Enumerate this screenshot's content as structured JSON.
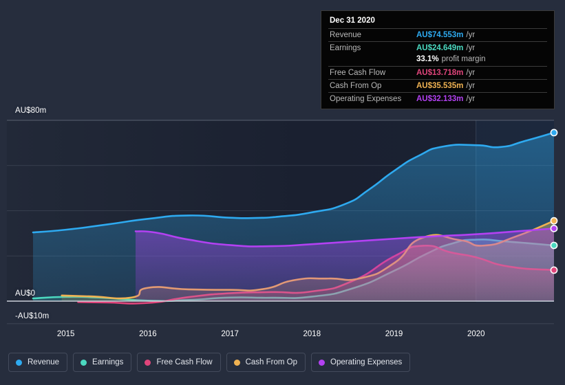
{
  "chart_data": {
    "type": "area",
    "title": "",
    "xlabel": "",
    "ylabel": "",
    "currency": "AU$",
    "ylim": [
      -10,
      90
    ],
    "grid": true,
    "legend_position": "bottom",
    "y_ticks": [
      "AU$80m",
      "AU$0",
      "-AU$10m"
    ],
    "y_tick_values": [
      80,
      0,
      -10
    ],
    "x_ticks": [
      "2015",
      "2016",
      "2017",
      "2018",
      "2019",
      "2020"
    ],
    "x_tick_values": [
      2015,
      2016,
      2017,
      2018,
      2019,
      2020
    ],
    "forecast_divider_x": 2020.0,
    "series": [
      {
        "name": "Revenue",
        "color": "#2eaaf0",
        "x": [
          2014.6,
          2015.0,
          2015.5,
          2016.0,
          2016.5,
          2017.0,
          2017.3,
          2017.6,
          2018.0,
          2018.4,
          2018.7,
          2019.0,
          2019.3,
          2019.6,
          2020.0,
          2020.3,
          2020.6,
          2020.95
        ],
        "values": [
          30.4,
          31.6,
          33.9,
          36.4,
          37.9,
          36.9,
          36.8,
          37.4,
          39.3,
          42.9,
          49.5,
          57.6,
          64.3,
          68.4,
          69.0,
          68.2,
          70.9,
          74.553
        ],
        "end_value": 74.553
      },
      {
        "name": "Earnings",
        "color": "#4bd9c0",
        "x": [
          2014.6,
          2015.0,
          2015.4,
          2016.0,
          2016.5,
          2017.0,
          2017.5,
          2018.0,
          2018.5,
          2019.0,
          2019.4,
          2019.7,
          2020.0,
          2020.4,
          2020.95
        ],
        "values": [
          1.2,
          1.9,
          1.6,
          0.2,
          0.5,
          1.6,
          1.5,
          2.0,
          5.7,
          13.4,
          21.0,
          25.4,
          27.2,
          26.3,
          24.649
        ],
        "end_value": 24.649
      },
      {
        "name": "Free Cash Flow",
        "color": "#e0457b",
        "x": [
          2015.15,
          2015.5,
          2016.0,
          2016.5,
          2017.0,
          2017.5,
          2018.0,
          2018.5,
          2019.0,
          2019.35,
          2019.7,
          2020.0,
          2020.4,
          2020.95
        ],
        "values": [
          -0.4,
          -0.6,
          -0.8,
          1.8,
          3.5,
          4.0,
          4.3,
          9.0,
          19.8,
          24.5,
          21.5,
          19.4,
          15.3,
          13.718
        ],
        "end_value": 13.718
      },
      {
        "name": "Cash From Op",
        "color": "#f0b252",
        "x": [
          2014.95,
          2015.3,
          2015.8,
          2016.0,
          2016.5,
          2017.0,
          2017.4,
          2017.8,
          2018.2,
          2018.6,
          2019.0,
          2019.35,
          2019.8,
          2020.1,
          2020.5,
          2020.95
        ],
        "values": [
          2.5,
          2.1,
          1.6,
          5.9,
          5.2,
          5.0,
          5.3,
          9.4,
          10.0,
          10.2,
          16.8,
          28.1,
          27.0,
          24.6,
          28.8,
          35.535
        ],
        "end_value": 35.535
      },
      {
        "name": "Operating Expenses",
        "color": "#b341f2",
        "x": [
          2015.85,
          2016.1,
          2016.5,
          2017.0,
          2017.5,
          2018.0,
          2018.5,
          2019.0,
          2019.5,
          2020.0,
          2020.5,
          2020.95
        ],
        "values": [
          30.9,
          30.3,
          27.2,
          24.8,
          24.3,
          25.2,
          26.4,
          27.6,
          28.7,
          29.6,
          30.9,
          32.133
        ],
        "end_value": 32.133
      }
    ]
  },
  "tooltip": {
    "title": "Dec 31 2020",
    "rows": [
      {
        "key": "Revenue",
        "value": "AU$74.553m",
        "unit": "/yr",
        "color": "#2eaaf0"
      },
      {
        "key": "Earnings",
        "value": "AU$24.649m",
        "unit": "/yr",
        "color": "#4bd9c0"
      },
      {
        "key": "",
        "value": "33.1%",
        "unit": "profit margin",
        "color": "#ffffff",
        "plain": true
      },
      {
        "key": "Free Cash Flow",
        "value": "AU$13.718m",
        "unit": "/yr",
        "color": "#e0457b"
      },
      {
        "key": "Cash From Op",
        "value": "AU$35.535m",
        "unit": "/yr",
        "color": "#f0b252"
      },
      {
        "key": "Operating Expenses",
        "value": "AU$32.133m",
        "unit": "/yr",
        "color": "#b341f2"
      }
    ]
  },
  "legend": {
    "items": [
      {
        "label": "Revenue",
        "color": "#2eaaf0"
      },
      {
        "label": "Earnings",
        "color": "#4bd9c0"
      },
      {
        "label": "Free Cash Flow",
        "color": "#e0457b"
      },
      {
        "label": "Cash From Op",
        "color": "#f0b252"
      },
      {
        "label": "Operating Expenses",
        "color": "#b341f2"
      }
    ]
  },
  "axis": {
    "y_top_label": "AU$80m",
    "y_zero_label": "AU$0",
    "y_neg_label": "-AU$10m"
  }
}
